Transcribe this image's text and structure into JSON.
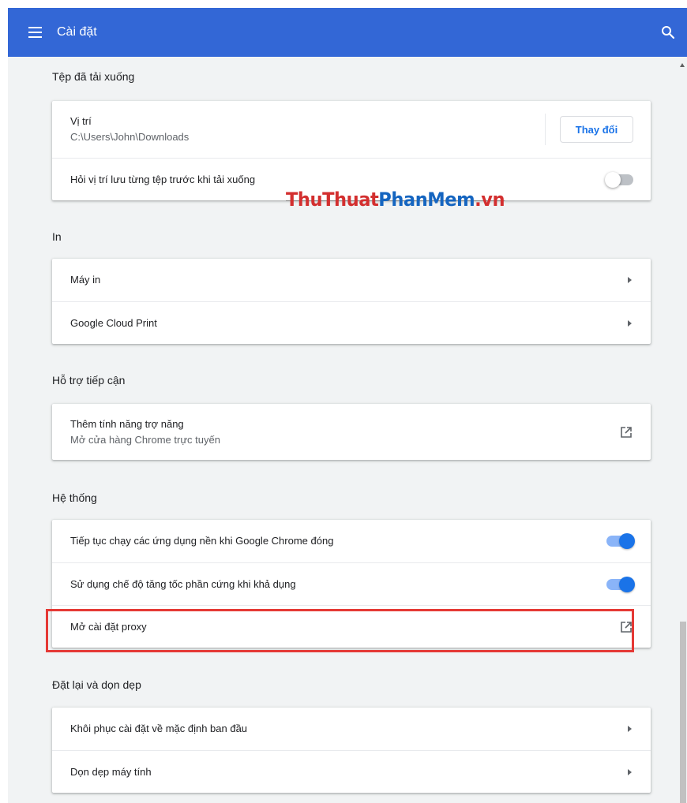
{
  "header": {
    "title": "Cài đặt",
    "bar_color": "#3367d6",
    "menu_icon": "hamburger-menu-icon",
    "search_icon": "search-icon"
  },
  "downloads": {
    "section_title": "Tệp đã tải xuống",
    "location_label": "Vị trí",
    "location_path": "C:\\Users\\John\\Downloads",
    "change_button": "Thay đổi",
    "ask_label": "Hỏi vị trí lưu từng tệp trước khi tải xuống",
    "ask_enabled": false
  },
  "printing": {
    "section_title": "In",
    "printers_label": "Máy in",
    "cloud_print_label": "Google Cloud Print"
  },
  "accessibility": {
    "section_title": "Hỗ trợ tiếp cận",
    "add_features_label": "Thêm tính năng trợ năng",
    "add_features_sub": "Mở cửa hàng Chrome trực tuyến"
  },
  "system": {
    "section_title": "Hệ thống",
    "background_apps_label": "Tiếp tục chạy các ứng dụng nền khi Google Chrome đóng",
    "background_apps_enabled": true,
    "hardware_accel_label": "Sử dụng chế độ tăng tốc phần cứng khi khả dụng",
    "hardware_accel_enabled": true,
    "proxy_label": "Mở cài đặt proxy"
  },
  "reset": {
    "section_title": "Đặt lại và dọn dẹp",
    "restore_label": "Khôi phục cài đặt về mặc định ban đầu",
    "cleanup_label": "Dọn dẹp máy tính"
  },
  "watermark": {
    "part1": "ThuThuat",
    "part2": "PhanMem",
    "part3": ".vn"
  },
  "colors": {
    "accent": "#1a73e8",
    "highlight_border": "#e53935"
  }
}
